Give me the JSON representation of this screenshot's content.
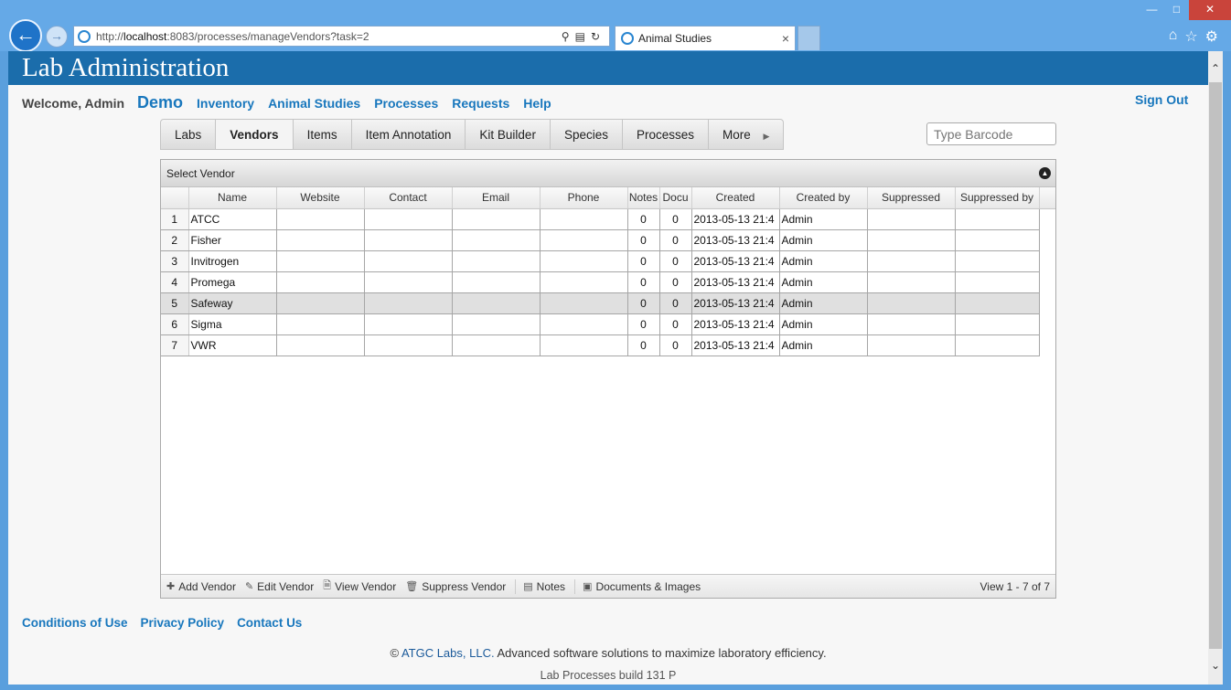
{
  "browser": {
    "url_prefix": "http://",
    "url_host": "localhost",
    "url_rest": ":8083/processes/manageVendors?task=2",
    "tab_title": "Animal Studies"
  },
  "app": {
    "title": "Lab Administration",
    "welcome": "Welcome, Admin",
    "brand": "Demo",
    "nav": [
      "Inventory",
      "Animal Studies",
      "Processes",
      "Requests",
      "Help"
    ],
    "sign_out": "Sign Out",
    "barcode_placeholder": "Type Barcode"
  },
  "subtabs": {
    "items": [
      "Labs",
      "Vendors",
      "Items",
      "Item Annotation",
      "Kit Builder",
      "Species",
      "Processes",
      "More"
    ],
    "active": "Vendors"
  },
  "grid": {
    "caption": "Select Vendor",
    "columns": [
      "Name",
      "Website",
      "Contact",
      "Email",
      "Phone",
      "Notes",
      "Docu",
      "Created",
      "Created by",
      "Suppressed",
      "Suppressed by"
    ],
    "rows": [
      {
        "n": "1",
        "name": "ATCC",
        "notes": "0",
        "docs": "0",
        "created": "2013-05-13 21:4",
        "created_by": "Admin"
      },
      {
        "n": "2",
        "name": "Fisher",
        "notes": "0",
        "docs": "0",
        "created": "2013-05-13 21:4",
        "created_by": "Admin"
      },
      {
        "n": "3",
        "name": "Invitrogen",
        "notes": "0",
        "docs": "0",
        "created": "2013-05-13 21:4",
        "created_by": "Admin"
      },
      {
        "n": "4",
        "name": "Promega",
        "notes": "0",
        "docs": "0",
        "created": "2013-05-13 21:4",
        "created_by": "Admin"
      },
      {
        "n": "5",
        "name": "Safeway",
        "notes": "0",
        "docs": "0",
        "created": "2013-05-13 21:4",
        "created_by": "Admin"
      },
      {
        "n": "6",
        "name": "Sigma",
        "notes": "0",
        "docs": "0",
        "created": "2013-05-13 21:4",
        "created_by": "Admin"
      },
      {
        "n": "7",
        "name": "VWR",
        "notes": "0",
        "docs": "0",
        "created": "2013-05-13 21:4",
        "created_by": "Admin"
      }
    ],
    "selected_row": "5",
    "pager_buttons": [
      "Add Vendor",
      "Edit Vendor",
      "View Vendor",
      "Suppress Vendor",
      "Notes",
      "Documents & Images"
    ],
    "view_info": "View 1 - 7 of 7"
  },
  "footer": {
    "links": [
      "Conditions of Use",
      "Privacy Policy",
      "Contact Us"
    ],
    "copyright_symbol": "©",
    "company": "ATGC Labs, LLC.",
    "tagline": "Advanced software solutions to maximize laboratory efficiency.",
    "build": "Lab Processes build 131 P"
  }
}
